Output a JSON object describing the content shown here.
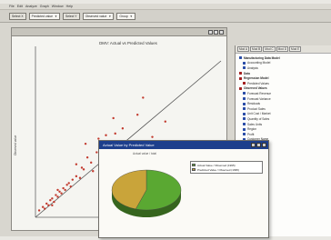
{
  "menubar": {
    "items": [
      "File",
      "Edit",
      "Analyze",
      "Graph",
      "Window",
      "Help"
    ]
  },
  "toolbar": {
    "buttons": [
      "Select X",
      "Select Y"
    ],
    "selects": [
      {
        "value": "Predicted value"
      },
      {
        "value": "Observed value"
      },
      {
        "value": "Group"
      }
    ]
  },
  "plot": {
    "title": "DMV: Actual vs Predicted Values",
    "ylabel": "Observed value"
  },
  "pie_window": {
    "title": "Actual Value by Predicted Value",
    "subtitle": "Actual value / total",
    "legend": [
      {
        "label": "Actual Value / Observed (1995)",
        "color": "#5aa832"
      },
      {
        "label": "Predicted Value / Observed (1995)",
        "color": "#c9a43a"
      }
    ],
    "slices": [
      {
        "name": "Actual Value / Observed (1995)",
        "value": 55,
        "color": "#5aa832"
      },
      {
        "name": "Predicted Value / Observed (1995)",
        "value": 45,
        "color": "#c9a43a"
      }
    ]
  },
  "sidebar": {
    "tabs": [
      "Mod A",
      "Mod B",
      "Mod C",
      "Mod D",
      "Mod E"
    ],
    "tree": [
      {
        "label": "Manufacturing Data Model",
        "bold": true,
        "color": "#2a4da8"
      },
      {
        "label": "Accounting Model",
        "bold": false,
        "color": "#2a4da8"
      },
      {
        "label": "Analysis",
        "bold": false,
        "color": "#2a4da8"
      },
      {
        "label": "Data",
        "bold": true,
        "color": "#a31f1f"
      },
      {
        "label": "Regression Model",
        "bold": true,
        "color": "#a31f1f"
      },
      {
        "label": "Predicted Values",
        "bold": false,
        "color": "#a31f1f"
      },
      {
        "label": "Observed Values",
        "bold": true,
        "color": "#a31f1f"
      },
      {
        "label": "Forecast Revenue",
        "bold": false,
        "color": "#2a4da8"
      },
      {
        "label": "Forecast Variance",
        "bold": false,
        "color": "#2a4da8"
      },
      {
        "label": "Residuals",
        "bold": false,
        "color": "#2a4da8"
      },
      {
        "label": "Product Sales",
        "bold": false,
        "color": "#2a4da8"
      },
      {
        "label": "Unit Cost / Market",
        "bold": false,
        "color": "#2a4da8"
      },
      {
        "label": "Quantity of Sales",
        "bold": false,
        "color": "#2a4da8"
      },
      {
        "label": "Sales Units",
        "bold": false,
        "color": "#2a4da8"
      },
      {
        "label": "Region",
        "bold": false,
        "color": "#2a4da8"
      },
      {
        "label": "Profit",
        "bold": false,
        "color": "#2a4da8"
      },
      {
        "label": "Customer Name",
        "bold": false,
        "color": "#2a4da8"
      },
      {
        "label": "Discount",
        "bold": false,
        "color": "#2a4da8"
      },
      {
        "label": "Categories",
        "bold": false,
        "color": "#2a4da8"
      },
      {
        "label": "Industry Sales",
        "bold": false,
        "color": "#2a4da8"
      },
      {
        "label": "Gross Sales",
        "bold": false,
        "color": "#2a4da8"
      },
      {
        "label": "Quantity",
        "bold": false,
        "color": "#2a4da8"
      },
      {
        "label": "Derived Measures",
        "bold": true,
        "color": "#a31f1f"
      },
      {
        "label": "Ratios",
        "bold": false,
        "color": "#2a4da8"
      }
    ]
  },
  "scatter_points": [
    [
      0.02,
      0.04
    ],
    [
      0.04,
      0.06
    ],
    [
      0.05,
      0.05
    ],
    [
      0.06,
      0.08
    ],
    [
      0.07,
      0.07
    ],
    [
      0.08,
      0.1
    ],
    [
      0.09,
      0.11
    ],
    [
      0.1,
      0.09
    ],
    [
      0.11,
      0.13
    ],
    [
      0.12,
      0.12
    ],
    [
      0.13,
      0.15
    ],
    [
      0.14,
      0.14
    ],
    [
      0.15,
      0.17
    ],
    [
      0.16,
      0.16
    ],
    [
      0.17,
      0.19
    ],
    [
      0.18,
      0.2
    ],
    [
      0.19,
      0.18
    ],
    [
      0.2,
      0.22
    ],
    [
      0.22,
      0.24
    ],
    [
      0.24,
      0.23
    ],
    [
      0.26,
      0.28
    ],
    [
      0.28,
      0.35
    ],
    [
      0.3,
      0.32
    ],
    [
      0.33,
      0.38
    ],
    [
      0.36,
      0.42
    ],
    [
      0.22,
      0.31
    ],
    [
      0.27,
      0.43
    ],
    [
      0.38,
      0.48
    ],
    [
      0.47,
      0.52
    ],
    [
      0.42,
      0.58
    ],
    [
      0.55,
      0.6
    ],
    [
      0.58,
      0.7
    ],
    [
      0.34,
      0.46
    ],
    [
      0.43,
      0.49
    ],
    [
      0.63,
      0.47
    ],
    [
      0.7,
      0.56
    ],
    [
      0.25,
      0.29
    ],
    [
      0.31,
      0.27
    ],
    [
      0.12,
      0.16
    ],
    [
      0.09,
      0.07
    ]
  ],
  "icons": [
    "minimize-icon",
    "maximize-icon",
    "close-icon",
    "folder-icon",
    "toolbar-tool-icon"
  ]
}
